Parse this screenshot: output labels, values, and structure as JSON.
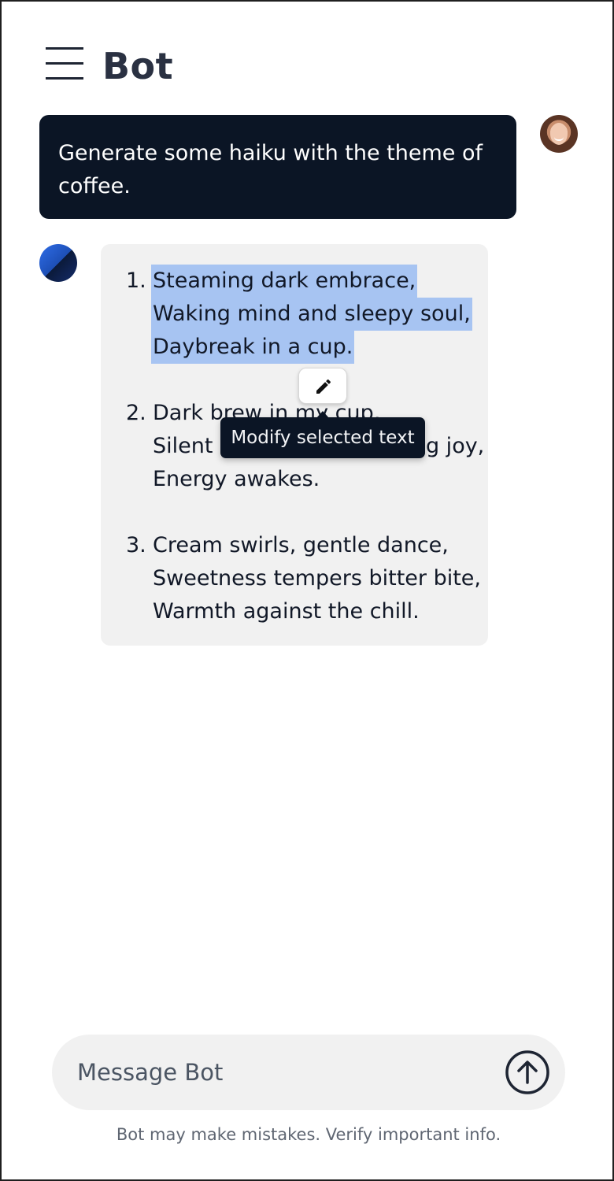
{
  "header": {
    "title": "Bot",
    "menu_icon": "hamburger-menu-icon"
  },
  "conversation": {
    "user_message": "Generate some haiku with the theme of coffee.",
    "user_avatar": "user-avatar-photo",
    "bot_avatar": "bot-avatar-logo",
    "haiku": [
      {
        "number": "1.",
        "lines": [
          "Steaming dark embrace,",
          "Waking mind and sleepy soul,",
          "Daybreak in a cup."
        ],
        "selected": true
      },
      {
        "number": "2.",
        "lines": [
          "Dark brew in my cup,",
          "Silent companion, morning joy,",
          "Energy awakes."
        ],
        "selected": false
      },
      {
        "number": "3.",
        "lines": [
          "Cream swirls, gentle dance,",
          "Sweetness tempers bitter bite,",
          "Warmth against the chill."
        ],
        "selected": false
      }
    ]
  },
  "selection_tools": {
    "edit_icon": "pencil-icon",
    "tooltip": "Modify selected text"
  },
  "composer": {
    "placeholder": "Message Bot",
    "value": "",
    "send_icon": "arrow-up-circle-icon"
  },
  "footer": {
    "disclaimer": "Bot may make mistakes. Verify important info."
  },
  "colors": {
    "user_bubble": "#0b1525",
    "bot_bubble": "#f1f1f1",
    "selection_highlight": "#a7c4f2",
    "title_text": "#2a3142"
  }
}
